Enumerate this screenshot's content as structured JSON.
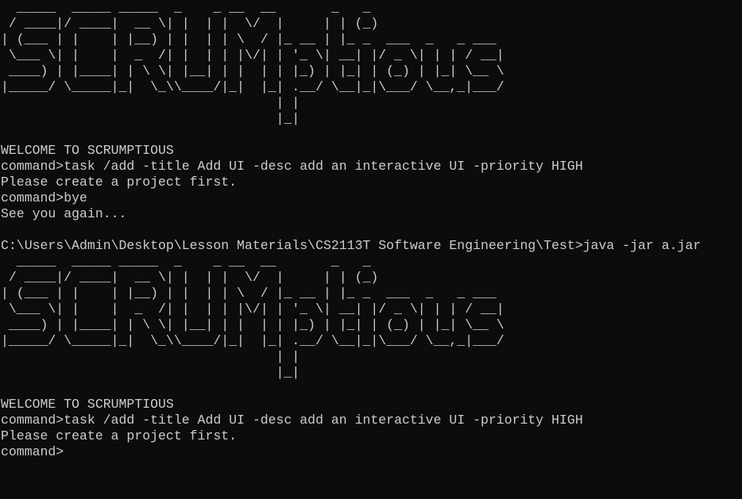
{
  "terminal": {
    "background": "#0c0c0c",
    "foreground": "#cccccc",
    "lines": [
      "  _____  _____ _____  _    _ __  __       _   _",
      " / ____|/ ____|  __ \\| |  | |  \\/  |     | | (_)",
      "| (___ | |    | |__) | |  | | \\  / |_ __ | |_ _  ___  _   _ ___",
      " \\___ \\| |    |  _  /| |  | | |\\/| | '_ \\| __| |/ _ \\| | | / __|",
      " ____) | |____| | \\ \\| |__| | |  | | |_) | |_| | (_) | |_| \\__ \\",
      "|_____/ \\_____|_|  \\_\\\\____/|_|  |_| .__/ \\__|_|\\___/ \\__,_|___/",
      "                                   | |",
      "                                   |_|",
      "",
      "WELCOME TO SCRUMPTIOUS",
      "command>task /add -title Add UI -desc add an interactive UI -priority HIGH",
      "Please create a project first.",
      "command>bye",
      "See you again...",
      "",
      "C:\\Users\\Admin\\Desktop\\Lesson Materials\\CS2113T Software Engineering\\Test>java -jar a.jar",
      "  _____  _____ _____  _    _ __  __       _   _",
      " / ____|/ ____|  __ \\| |  | |  \\/  |     | | (_)",
      "| (___ | |    | |__) | |  | | \\  / |_ __ | |_ _  ___  _   _ ___",
      " \\___ \\| |    |  _  /| |  | | |\\/| | '_ \\| __| |/ _ \\| | | / __|",
      " ____) | |____| | \\ \\| |__| | |  | | |_) | |_| | (_) | |_| \\__ \\",
      "|_____/ \\_____|_|  \\_\\\\____/|_|  |_| .__/ \\__|_|\\___/ \\__,_|___/",
      "                                   | |",
      "                                   |_|",
      "",
      "WELCOME TO SCRUMPTIOUS",
      "command>task /add -title Add UI -desc add an interactive UI -priority HIGH",
      "Please create a project first."
    ],
    "current_prompt": "command>"
  }
}
